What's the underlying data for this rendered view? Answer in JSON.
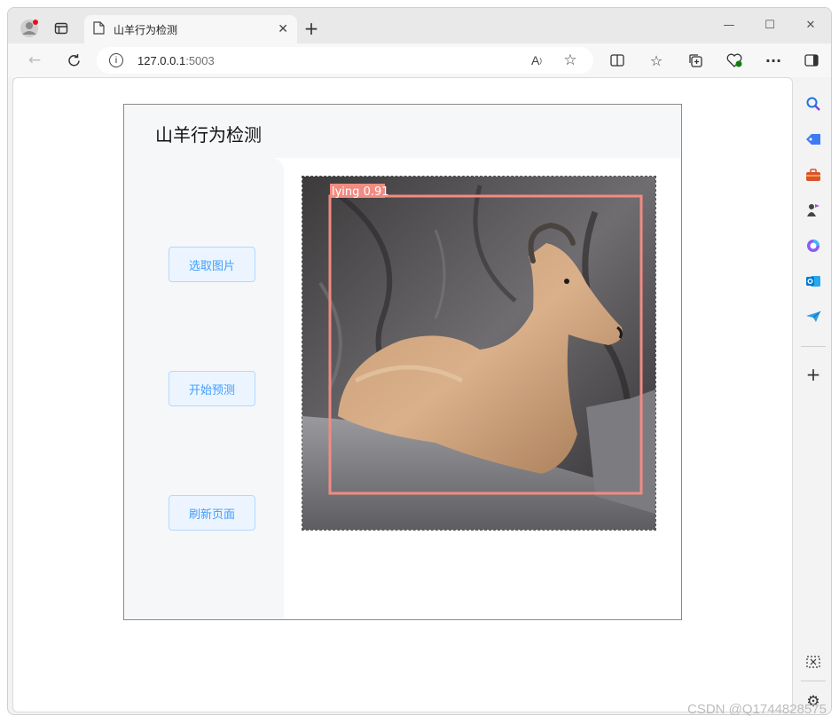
{
  "browser": {
    "tab_title": "山羊行为检测",
    "url_host": "127.0.0.1",
    "url_port": ":5003",
    "new_tab_symbol": "+",
    "window_controls": [
      "—",
      "☐",
      "✕"
    ]
  },
  "app": {
    "title": "山羊行为检测",
    "buttons": [
      "选取图片",
      "开始预测",
      "刷新页面"
    ]
  },
  "detection": {
    "label": "lying",
    "confidence": "0.91",
    "box_color": "#f28b82"
  },
  "watermark": "CSDN @Q1744828575",
  "colors": {
    "button_bg": "#ecf5ff",
    "button_border": "#b3d8ff",
    "button_text": "#409eff",
    "panel_bg": "#f6f7f9"
  },
  "icons": {
    "profile": "profile-icon",
    "tab_actions": "tab-actions-icon",
    "page": "page-icon",
    "back": "back-icon",
    "refresh": "refresh-icon",
    "info": "info-icon",
    "read_aloud": "read-aloud-icon",
    "favorite": "star-icon",
    "split": "split-screen-icon",
    "favorites": "favorites-icon",
    "collections": "collections-icon",
    "health": "browser-essentials-icon",
    "more": "more-icon",
    "sidebar_toggle": "sidebar-toggle-icon",
    "search": "search-icon",
    "shopping": "shopping-tag-icon",
    "tools": "toolbox-icon",
    "games": "games-icon",
    "copilot": "copilot-icon",
    "outlook": "outlook-icon",
    "send": "send-icon",
    "add": "add-icon",
    "screenshot": "screenshot-icon",
    "settings": "settings-icon"
  }
}
